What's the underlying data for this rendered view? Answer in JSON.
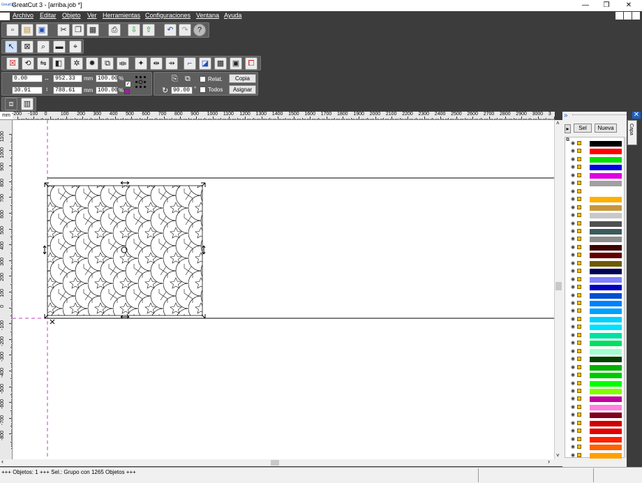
{
  "window": {
    "title": "GreatCut 3 - [arriba.job *]",
    "app_icon_label": "GreatCut",
    "minimize": "—",
    "restore": "❐",
    "close": "✕",
    "child_minimize": "_",
    "child_restore": "❐",
    "child_close": "✕"
  },
  "menu": [
    "Archivo",
    "Editar",
    "Objeto",
    "Ver",
    "Herramientas",
    "Configuraciones",
    "Ventana",
    "Ayuda"
  ],
  "toolbar1": [
    "new-file",
    "open-file",
    "save",
    "cut",
    "copy",
    "paste",
    "print",
    "import",
    "export",
    "undo",
    "redo",
    "help"
  ],
  "toolbar2": [
    "select-arrow",
    "object-box",
    "zoom",
    "ruler-tool",
    "node-tool"
  ],
  "toolbar3": [
    "delete",
    "rotate",
    "mirror",
    "transform",
    "weld",
    "contour",
    "align",
    "distribute",
    "center",
    "arrange",
    "group",
    "ungroup",
    "bring-front",
    "send-back"
  ],
  "props": {
    "x": "0.00",
    "y": "30.91",
    "width": "952.33",
    "height": "788.61",
    "unit1": "mm",
    "unit2": "mm",
    "scale_w": "100.00",
    "scale_h": "100.00",
    "pct1": "%",
    "pct2": "%",
    "angle": "90.00",
    "deg": "°",
    "relative_label": "Relat.",
    "all_label": "Todos",
    "copy_button": "Copia",
    "assign_button": "Asignar"
  },
  "ruler": {
    "unit": "mm",
    "h_ticks": [
      "-200",
      "-100",
      "0",
      "100",
      "200",
      "300",
      "400",
      "500",
      "600",
      "700",
      "800",
      "900",
      "1000",
      "1100",
      "1200",
      "1300",
      "1400",
      "1500",
      "1600",
      "1700",
      "1800",
      "1900",
      "2000",
      "2100",
      "2200",
      "2300",
      "2400",
      "2500",
      "2600",
      "2700",
      "2800",
      "2900",
      "3000",
      "3"
    ],
    "v_ticks": [
      "1100",
      "1000",
      "900",
      "800",
      "700",
      "600",
      "500",
      "400",
      "300",
      "200",
      "100",
      "0",
      "-100",
      "-200",
      "-300",
      "-400",
      "-500",
      "-600",
      "-700",
      "-800"
    ]
  },
  "panel": {
    "sel_button": "Sel",
    "new_button": "Nueva",
    "tab_label": "Capa",
    "play": "▸",
    "layers": [
      "#000000",
      "#ff0000",
      "#00e000",
      "#0000e0",
      "#e000e0",
      "#a0a0a0",
      "#ffffff",
      "#ffb000",
      "#c8963c",
      "#c8c8c8",
      "#505050",
      "#3c5a5a",
      "#8c8c8c",
      "#3c0000",
      "#600000",
      "#6e5a00",
      "#000050",
      "#8080ff",
      "#0000c0",
      "#0050d0",
      "#0080ff",
      "#00a0ff",
      "#00d0ff",
      "#00e0ff",
      "#00e0a0",
      "#00e060",
      "#a0ffd0",
      "#004000",
      "#00b000",
      "#00c800",
      "#00ff00",
      "#80ff00",
      "#c000a0",
      "#ff80e0",
      "#800020",
      "#d00000",
      "#e00000",
      "#ff2000",
      "#ff6000",
      "#ffa000"
    ]
  },
  "status": {
    "text": "+++ Objetos: 1 +++ Sel.: Grupo con 1265 Objetos +++"
  }
}
